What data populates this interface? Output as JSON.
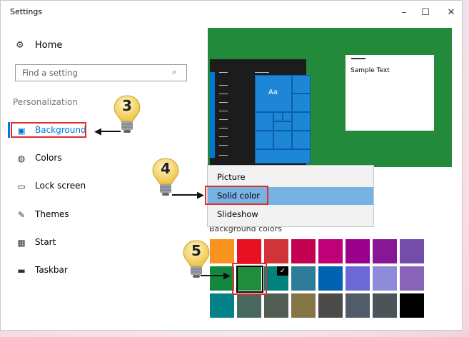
{
  "window": {
    "title": "Settings",
    "min_glyph": "–",
    "max_glyph": "☐",
    "close_glyph": "✕"
  },
  "home": {
    "label": "Home",
    "icon": "gear-icon"
  },
  "search": {
    "placeholder": "Find a setting",
    "icon": "search-icon"
  },
  "section": "Personalization",
  "nav": [
    {
      "label": "Background",
      "icon": "picture-icon",
      "active": true
    },
    {
      "label": "Colors",
      "icon": "palette-icon"
    },
    {
      "label": "Lock screen",
      "icon": "lock-screen-icon"
    },
    {
      "label": "Themes",
      "icon": "brush-icon"
    },
    {
      "label": "Start",
      "icon": "start-tiles-icon"
    },
    {
      "label": "Taskbar",
      "icon": "taskbar-icon"
    }
  ],
  "preview": {
    "tile_text": "Aa",
    "sample_text": "Sample Text",
    "accent": "#238a3c"
  },
  "dropdown": {
    "options": [
      "Picture",
      "Solid color",
      "Slideshow"
    ],
    "selected": "Solid color"
  },
  "bg_colors_label": "Background colors",
  "swatches": {
    "selected_index": 10,
    "check": "✓",
    "rows": [
      [
        "#f7931e",
        "#e81123",
        "#d13438",
        "#c30052",
        "#bf0077",
        "#9a0089",
        "#881798",
        "#744da9"
      ],
      [
        "#10893e",
        "#218c3b",
        "#00837d",
        "#2d7d9a",
        "#0063b1",
        "#6b69d6",
        "#8e8cd8",
        "#8764b8"
      ],
      [
        "#038387",
        "#486860",
        "#525e54",
        "#847545",
        "#4c4a48",
        "#515c6b",
        "#4a5459",
        "#000000"
      ]
    ]
  },
  "callouts": [
    "3",
    "4",
    "5"
  ]
}
